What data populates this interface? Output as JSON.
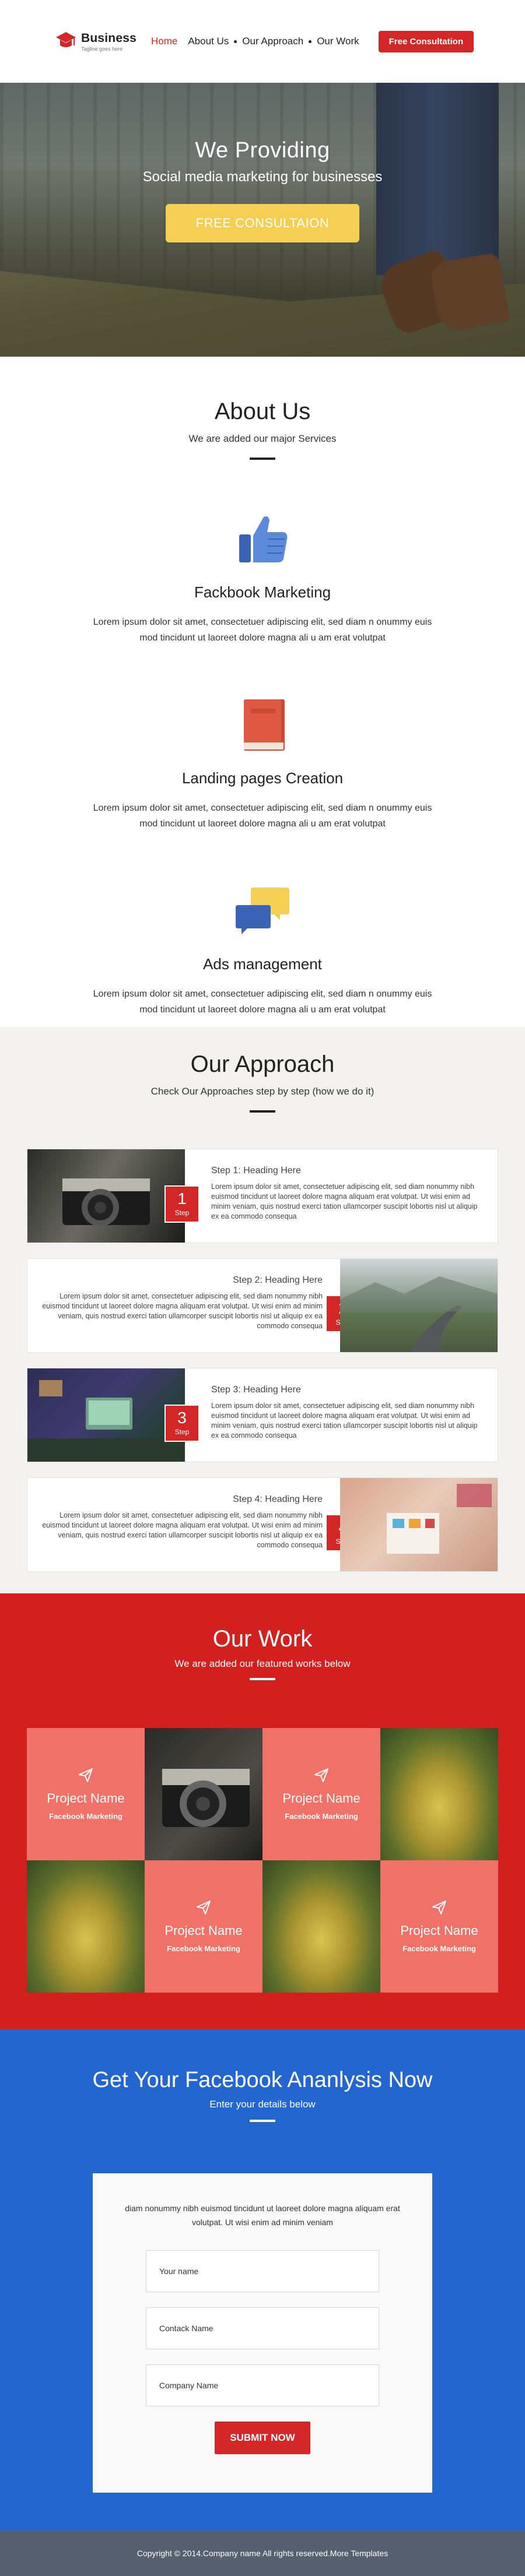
{
  "header": {
    "logo_title": "Business",
    "logo_tagline": "Tagline goes here",
    "nav": [
      {
        "label": "Home"
      },
      {
        "label": "About Us"
      },
      {
        "label": "Our Approach"
      },
      {
        "label": "Our Work"
      }
    ],
    "cta_label": "Free Consultation",
    "accent_color": "#d32626"
  },
  "hero": {
    "title": "We Providing",
    "subtitle": "Social media marketing for businesses",
    "button_label": "FREE CONSULTAION"
  },
  "about": {
    "title": "About Us",
    "subtitle": "We are added our major Services",
    "services": [
      {
        "icon": "thumbs-up-icon",
        "title": "Fackbook Marketing",
        "text": "Lorem ipsum dolor sit amet, consectetuer adipiscing elit, sed diam n onummy euis mod tincidunt ut laoreet dolore magna ali   u am erat volutpat"
      },
      {
        "icon": "book-icon",
        "title": "Landing pages Creation",
        "text": "Lorem ipsum dolor sit amet, consectetuer adipiscing elit, sed diam n onummy euis mod tincidunt ut laoreet dolore magna ali   u am erat volutpat"
      },
      {
        "icon": "chat-bubbles-icon",
        "title": "Ads management",
        "text": "Lorem ipsum dolor sit amet, consectetuer adipiscing elit, sed diam n onummy euis mod tincidunt ut laoreet dolore magna ali   u am erat volutpat"
      }
    ]
  },
  "approach": {
    "title": "Our Approach",
    "subtitle": "Check Our Approaches step by step (how we do it)",
    "steps": [
      {
        "heading": "Step 1: Heading Here",
        "number": "1",
        "step_label": "Step",
        "text": "Lorem ipsum dolor sit amet, consectetuer adipiscing elit, sed diam nonummy nibh euismod tincidunt ut laoreet dolore magna aliquam erat volutpat. Ut wisi enim ad minim veniam, quis nostrud exerci tation ullamcorper suscipit lobortis nisl ut aliquip ex ea commodo consequa"
      },
      {
        "heading": "Step 2: Heading Here",
        "number": "2",
        "step_label": "Step",
        "text": "Lorem ipsum dolor sit amet, consectetuer adipiscing elit, sed diam nonummy nibh euismod tincidunt ut laoreet dolore magna aliquam erat volutpat. Ut wisi enim ad minim veniam, quis nostrud exerci tation ullamcorper suscipit lobortis nisl ut aliquip ex ea commodo consequa"
      },
      {
        "heading": "Step 3: Heading Here",
        "number": "3",
        "step_label": "Step",
        "text": "Lorem ipsum dolor sit amet, consectetuer adipiscing elit, sed diam nonummy nibh euismod tincidunt ut laoreet dolore magna aliquam erat volutpat. Ut wisi enim ad minim veniam, quis nostrud exerci tation ullamcorper suscipit lobortis nisl ut aliquip ex ea commodo consequa"
      },
      {
        "heading": "Step 4: Heading Here",
        "number": "4",
        "step_label": "Step",
        "text": "Lorem ipsum dolor sit amet, consectetuer adipiscing elit, sed diam nonummy nibh euismod tincidunt ut laoreet dolore magna aliquam erat volutpat. Ut wisi enim ad minim veniam, quis nostrud exerci tation ullamcorper suscipit lobortis nisl ut aliquip ex ea commodo consequa"
      }
    ]
  },
  "work": {
    "title": "Our Work",
    "subtitle": "We are added our featured works below",
    "project_name": "Project Name",
    "project_category": "Facebook Marketing"
  },
  "analysis": {
    "title": "Get Your Facebook Ananlysis Now",
    "subtitle": "Enter your details below",
    "intro": "diam nonummy nibh euismod tincidunt ut laoreet dolore magna aliquam erat volutpat. Ut wisi enim ad minim veniam",
    "fields": [
      {
        "placeholder": "Your name"
      },
      {
        "placeholder": "Contack Name"
      },
      {
        "placeholder": "Company Name"
      }
    ],
    "submit_label": "SUBMIT NOW"
  },
  "footer": {
    "copyright": "Copyright © 2014.Company name All rights reserved.More Templates"
  }
}
